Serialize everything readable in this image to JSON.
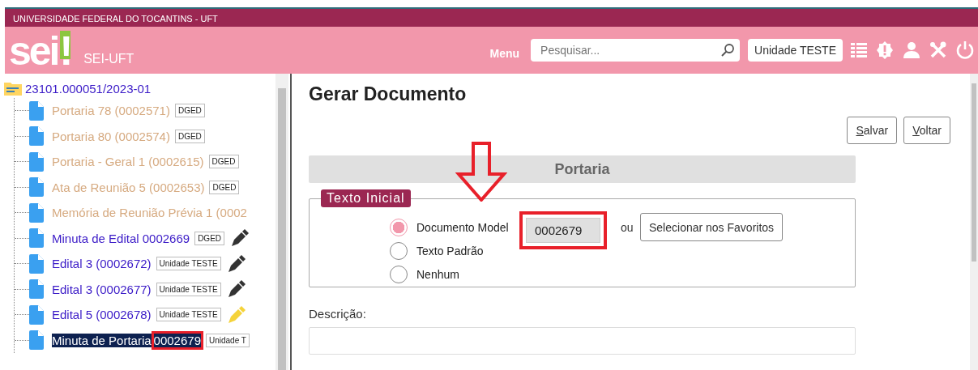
{
  "org_banner": "UNIVERSIDADE FEDERAL DO TOCANTINS - UFT",
  "header": {
    "logo": "sei",
    "logo_mark": "!",
    "system": "SEI-UFT",
    "menu": "Menu",
    "search": {
      "placeholder": "Pesquisar..."
    },
    "unit": "Unidade TESTE"
  },
  "tree": {
    "process": "23101.000051/2023-01",
    "items": [
      {
        "label": "Portaria 78 (0002571)",
        "tag": "DGED",
        "dimmed": true,
        "selected": false
      },
      {
        "label": "Portaria 80 (0002574)",
        "tag": "DGED",
        "dimmed": true,
        "selected": false
      },
      {
        "label": "Portaria - Geral 1 (0002615)",
        "tag": "DGED",
        "dimmed": true,
        "selected": false
      },
      {
        "label": "Ata de Reunião 5 (0002653)",
        "tag": "DGED",
        "dimmed": true,
        "selected": false
      },
      {
        "label": "Memória de Reunião Prévia 1 (0002",
        "dimmed": true,
        "selected": false
      },
      {
        "label": "Minuta de Edital 0002669",
        "tag": "DGED",
        "dimmed": false,
        "selected": false,
        "pen": {
          "color": "#333333"
        }
      },
      {
        "label": "Edital 3 (0002672)",
        "tag": "Unidade TESTE",
        "dimmed": false,
        "selected": false,
        "pen": {
          "color": "#333333"
        }
      },
      {
        "label": "Edital 3 (0002677)",
        "tag": "Unidade TESTE",
        "dimmed": false,
        "selected": false,
        "pen": {
          "color": "#333333"
        }
      },
      {
        "label": "Edital 5 (0002678)",
        "tag": "Unidade TESTE",
        "dimmed": false,
        "selected": false,
        "pen": {
          "color": "#f5d33a"
        }
      },
      {
        "label": "Minuta de Portaria",
        "marked": "0002679",
        "tag": "Unidade T",
        "dimmed": false,
        "selected": true
      }
    ]
  },
  "page": {
    "title": "Gerar Documento",
    "buttons": [
      "Salvar",
      "Voltar"
    ],
    "section": "Portaria",
    "initial_text": {
      "legend": "Texto Inicial",
      "options": [
        {
          "label": "Documento Model",
          "selected": true,
          "kind": "model"
        },
        {
          "label": "Texto Padrão",
          "selected": false,
          "kind": "plain"
        },
        {
          "label": "Nenhum",
          "selected": false,
          "kind": "plain"
        }
      ],
      "model_value": "0002679",
      "or": "ou",
      "favorites_button": "Selecionar nos Favoritos"
    },
    "description": {
      "label": "Descrição:"
    }
  }
}
